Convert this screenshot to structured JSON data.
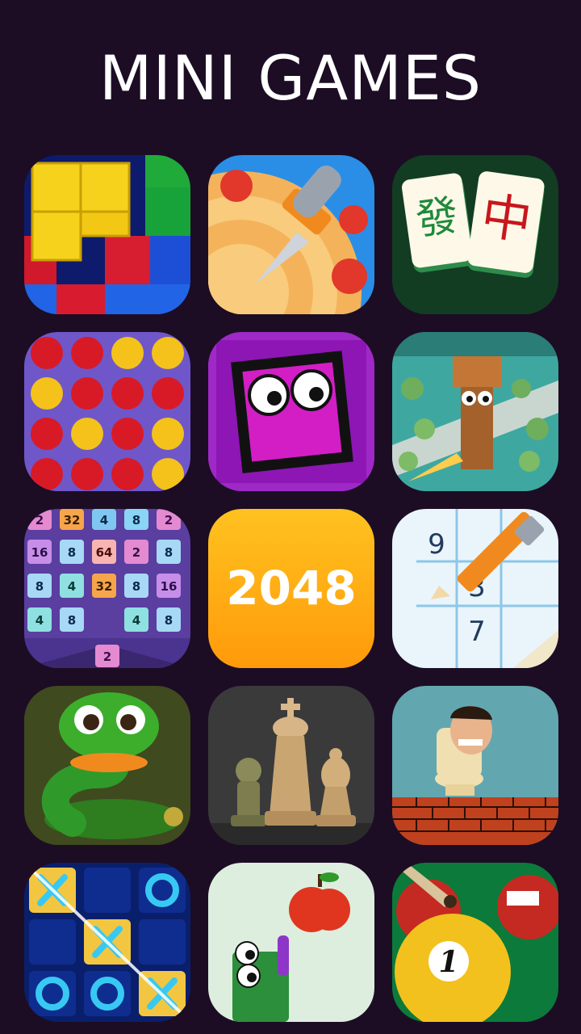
{
  "header": {
    "title": "MINI GAMES"
  },
  "games": [
    {
      "icon": "block-puzzle-icon"
    },
    {
      "icon": "knife-hit-icon"
    },
    {
      "icon": "mahjong-icon",
      "glyphs": [
        "發",
        "中"
      ]
    },
    {
      "icon": "connect-four-icon"
    },
    {
      "icon": "geometry-cube-icon"
    },
    {
      "icon": "tower-defense-icon"
    },
    {
      "icon": "number-merge-icon",
      "cells": [
        "2",
        "32",
        "4",
        "8",
        "2",
        "16",
        "8",
        "64",
        "2",
        "8",
        "8",
        "4",
        "32",
        "8",
        "16",
        "4",
        "8",
        "",
        "4",
        "8"
      ],
      "shooter": "2"
    },
    {
      "icon": "2048-icon",
      "label": "2048"
    },
    {
      "icon": "sudoku-icon",
      "digits": [
        "9",
        "3",
        "7"
      ]
    },
    {
      "icon": "snake-icon"
    },
    {
      "icon": "chess-icon"
    },
    {
      "icon": "toilet-runner-icon"
    },
    {
      "icon": "tic-tac-toe-icon"
    },
    {
      "icon": "snake-apple-icon"
    },
    {
      "icon": "billiards-icon",
      "ball_number": "1"
    }
  ]
}
